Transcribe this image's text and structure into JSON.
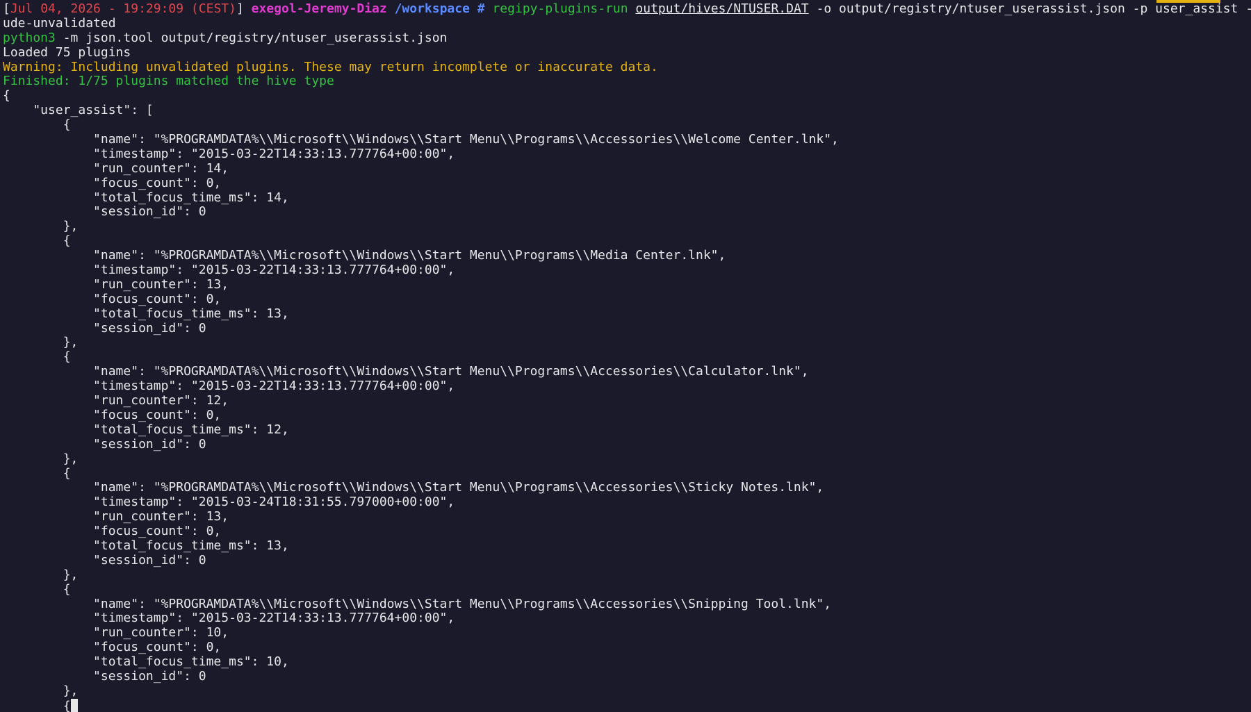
{
  "prompt": {
    "open_bracket": "[",
    "datetime": "Jul 04, 2026 - 19:29:09 (CEST)",
    "close_bracket": "]",
    "host": "exegol-Jeremy-Diaz",
    "cwd": "/workspace",
    "hash": "#",
    "command": "regipy-plugins-run",
    "hive_path": "output/hives/NTUSER.DAT",
    "args": "-o output/registry/ntuser_userassist.json -p user_assist --incl",
    "args_wrap": "ude-unvalidated"
  },
  "second_command": {
    "program": "python3",
    "args": "-m json.tool output/registry/ntuser_userassist.json"
  },
  "output": {
    "loaded": "Loaded 75 plugins",
    "warning": "Warning: Including unvalidated plugins. These may return incomplete or inaccurate data.",
    "finished": "Finished: 1/75 plugins matched the hive type"
  },
  "json_lines": [
    "{",
    "    \"user_assist\": [",
    "        {",
    "            \"name\": \"%PROGRAMDATA%\\\\Microsoft\\\\Windows\\\\Start Menu\\\\Programs\\\\Accessories\\\\Welcome Center.lnk\",",
    "            \"timestamp\": \"2015-03-22T14:33:13.777764+00:00\",",
    "            \"run_counter\": 14,",
    "            \"focus_count\": 0,",
    "            \"total_focus_time_ms\": 14,",
    "            \"session_id\": 0",
    "        },",
    "        {",
    "            \"name\": \"%PROGRAMDATA%\\\\Microsoft\\\\Windows\\\\Start Menu\\\\Programs\\\\Media Center.lnk\",",
    "            \"timestamp\": \"2015-03-22T14:33:13.777764+00:00\",",
    "            \"run_counter\": 13,",
    "            \"focus_count\": 0,",
    "            \"total_focus_time_ms\": 13,",
    "            \"session_id\": 0",
    "        },",
    "        {",
    "            \"name\": \"%PROGRAMDATA%\\\\Microsoft\\\\Windows\\\\Start Menu\\\\Programs\\\\Accessories\\\\Calculator.lnk\",",
    "            \"timestamp\": \"2015-03-22T14:33:13.777764+00:00\",",
    "            \"run_counter\": 12,",
    "            \"focus_count\": 0,",
    "            \"total_focus_time_ms\": 12,",
    "            \"session_id\": 0",
    "        },",
    "        {",
    "            \"name\": \"%PROGRAMDATA%\\\\Microsoft\\\\Windows\\\\Start Menu\\\\Programs\\\\Accessories\\\\Sticky Notes.lnk\",",
    "            \"timestamp\": \"2015-03-24T18:31:55.797000+00:00\",",
    "            \"run_counter\": 13,",
    "            \"focus_count\": 0,",
    "            \"total_focus_time_ms\": 13,",
    "            \"session_id\": 0",
    "        },",
    "        {",
    "            \"name\": \"%PROGRAMDATA%\\\\Microsoft\\\\Windows\\\\Start Menu\\\\Programs\\\\Accessories\\\\Snipping Tool.lnk\",",
    "            \"timestamp\": \"2015-03-22T14:33:13.777764+00:00\",",
    "            \"run_counter\": 10,",
    "            \"focus_count\": 0,",
    "            \"total_focus_time_ms\": 10,",
    "            \"session_id\": 0",
    "        },"
  ],
  "last_line": "        {",
  "colors": {
    "background": "#1b1a2b",
    "foreground": "#e7e7e9",
    "date_red": "#e0474d",
    "host_magenta": "#e13bd0",
    "path_blue": "#5c8cff",
    "command_green": "#33c23f",
    "warning_amber": "#e5b312"
  }
}
